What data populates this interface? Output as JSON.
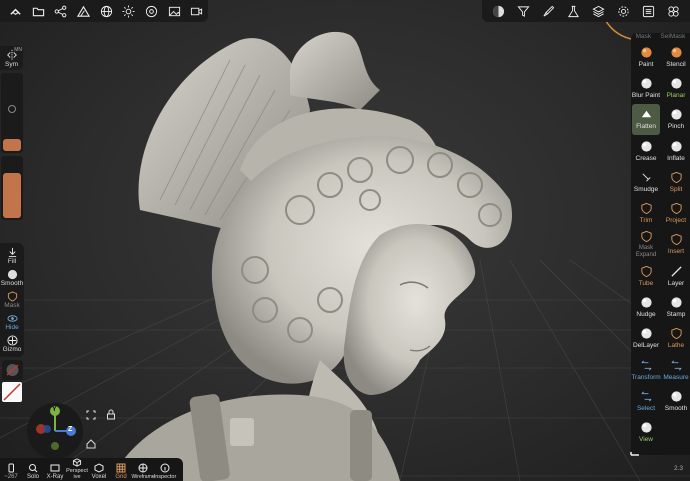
{
  "colors": {
    "accent": "#c2754b",
    "active_tool_bg": "#4d5b44",
    "panel_bg": "#161616",
    "label_highlight": "#d89a5f",
    "label_blue": "#6fa8dc",
    "label_green": "#9ccc65",
    "label_muted": "#8a8a8a"
  },
  "top_left_toolbar": [
    {
      "name": "scene-icon"
    },
    {
      "name": "folder-icon"
    },
    {
      "name": "share-icon"
    },
    {
      "name": "mountain-icon"
    },
    {
      "name": "globe-icon"
    },
    {
      "name": "sun-icon"
    },
    {
      "name": "stamp-icon"
    },
    {
      "name": "image-icon"
    },
    {
      "name": "video-icon"
    }
  ],
  "top_right_toolbar": [
    {
      "name": "matcap-icon"
    },
    {
      "name": "filter-icon"
    },
    {
      "name": "brush-icon"
    },
    {
      "name": "material-icon"
    },
    {
      "name": "layers-icon"
    },
    {
      "name": "settings-icon"
    },
    {
      "name": "menu-icon"
    },
    {
      "name": "group-icon"
    }
  ],
  "left_panel": {
    "sym_label": "Sym",
    "sym_corner": "MN",
    "radius_level": 0.16,
    "intensity_level": 0.75
  },
  "left_tools": [
    {
      "label": "Fill",
      "icon": "fill-icon"
    },
    {
      "label": "Smooth",
      "icon": "smooth-icon"
    },
    {
      "label": "Mask",
      "icon": "mask-icon",
      "muted": true
    },
    {
      "label": "Hide",
      "icon": "hide-icon",
      "blue": true
    },
    {
      "label": "Gizmo",
      "icon": "gizmo-icon"
    }
  ],
  "right_panel": {
    "tabs": [
      "Mask",
      "SelMask"
    ],
    "tools": [
      {
        "label": "Paint",
        "icon": "paint-icon",
        "color": "normal"
      },
      {
        "label": "Stencil",
        "icon": "stencil-icon",
        "color": "normal"
      },
      {
        "label": "Blur Paint",
        "icon": "blur-paint-icon",
        "color": "normal"
      },
      {
        "label": "Planar",
        "icon": "planar-icon",
        "color": "green"
      },
      {
        "label": "Flatten",
        "icon": "flatten-icon",
        "color": "normal",
        "active": true
      },
      {
        "label": "Pinch",
        "icon": "pinch-icon",
        "color": "normal"
      },
      {
        "label": "Crease",
        "icon": "crease-icon",
        "color": "normal"
      },
      {
        "label": "Inflate",
        "icon": "inflate-icon",
        "color": "normal"
      },
      {
        "label": "Smudge",
        "icon": "smudge-icon",
        "color": "normal"
      },
      {
        "label": "Split",
        "icon": "split-icon",
        "color": "highlight"
      },
      {
        "label": "Trim",
        "icon": "trim-icon",
        "color": "highlight"
      },
      {
        "label": "Project",
        "icon": "project-icon",
        "color": "highlight"
      },
      {
        "label": "Mask Expand",
        "icon": "mask-expand-icon",
        "color": "muted"
      },
      {
        "label": "Insert",
        "icon": "insert-icon",
        "color": "highlight"
      },
      {
        "label": "Tube",
        "icon": "tube-icon",
        "color": "highlight"
      },
      {
        "label": "Layer",
        "icon": "layer-icon",
        "color": "normal"
      },
      {
        "label": "Nudge",
        "icon": "nudge-icon",
        "color": "normal"
      },
      {
        "label": "Stamp",
        "icon": "stamp-icon",
        "color": "normal"
      },
      {
        "label": "DelLayer",
        "icon": "dellayer-icon",
        "color": "normal"
      },
      {
        "label": "Lathe",
        "icon": "lathe-icon",
        "color": "highlight"
      },
      {
        "label": "Transform",
        "icon": "transform-icon",
        "color": "blue"
      },
      {
        "label": "Measure",
        "icon": "measure-icon",
        "color": "blue"
      },
      {
        "label": "Select",
        "icon": "select-icon",
        "color": "blue"
      },
      {
        "label": "Smooth",
        "icon": "smooth-icon",
        "color": "normal"
      },
      {
        "label": "View",
        "icon": "view-icon",
        "color": "green"
      }
    ]
  },
  "gizmo": {
    "y_label": "Y",
    "z_label": "Z"
  },
  "bottom_bar": {
    "counter": "~267",
    "items": [
      {
        "label": "",
        "icon": "phone-icon"
      },
      {
        "label": "Solo",
        "icon": "search-icon"
      },
      {
        "label": "X-Ray",
        "icon": "xray-icon"
      },
      {
        "label": "Perspect ive",
        "icon": "cube-icon"
      },
      {
        "label": "Voxel",
        "icon": "voxel-icon"
      },
      {
        "label": "Grid",
        "icon": "grid-icon",
        "accent": true
      },
      {
        "label": "Wireframe",
        "icon": "wireframe-icon"
      },
      {
        "label": "Inspector",
        "icon": "inspector-icon"
      }
    ]
  },
  "version_hint": "2.3"
}
